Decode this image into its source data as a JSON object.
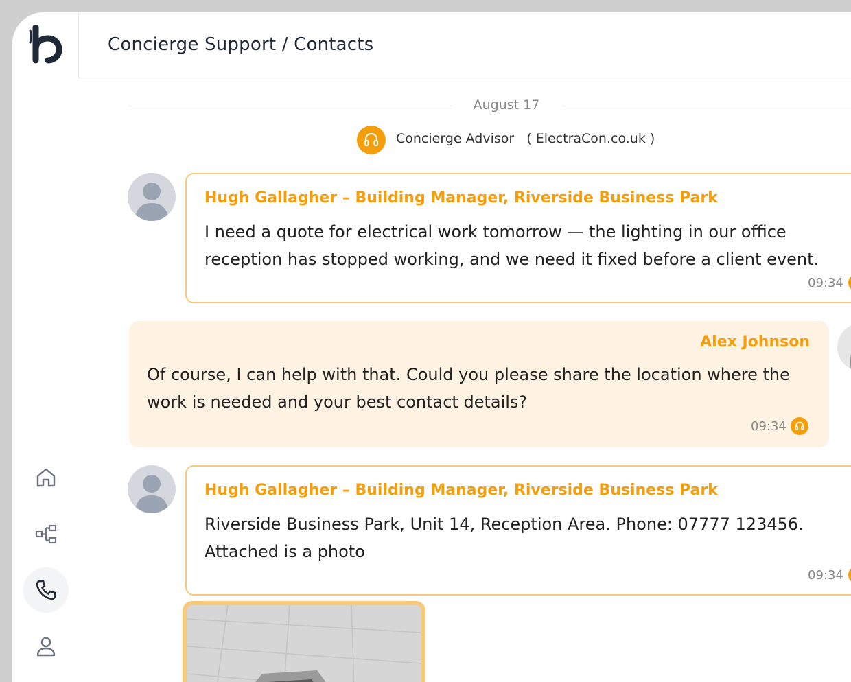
{
  "header": {
    "title": "Concierge Support / Contacts"
  },
  "sidebar": {
    "items": [
      {
        "icon": "home-icon"
      },
      {
        "icon": "hierarchy-icon"
      },
      {
        "icon": "phone-icon",
        "active": true
      },
      {
        "icon": "user-icon"
      }
    ]
  },
  "chat": {
    "date": "August 17",
    "advisor": {
      "label": "Concierge Advisor",
      "company": "( ElectraCon.co.uk )"
    },
    "messages": [
      {
        "sender": "Hugh Gallagher – Building Manager, Riverside Business Park",
        "line1": "I need a quote for electrical work tomorrow — the lighting in our office",
        "line2": "reception has stopped working, and we need it fixed before a client event.",
        "time": "09:34"
      },
      {
        "sender": "Alex Johnson",
        "line1": "Of course, I can help with that. Could you please share the location where the",
        "line2": "work is needed and your best contact details?",
        "time": "09:34"
      },
      {
        "sender": "Hugh Gallagher – Building Manager, Riverside Business Park",
        "line1": "Riverside Business Park, Unit 14, Reception Area. Phone: 07777 123456.",
        "line2": "Attached is a photo",
        "time": "09:34"
      }
    ]
  },
  "colors": {
    "accent": "#f59e0b",
    "accent_border": "#f9c97a",
    "outgoing_bg": "#fef3e2"
  }
}
